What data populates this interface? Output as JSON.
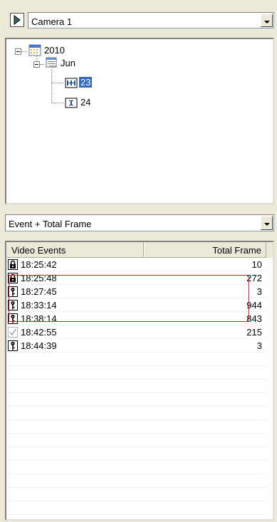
{
  "camera_select": {
    "value": "Camera 1"
  },
  "tree": {
    "year": "2010",
    "month": "Jun",
    "days": [
      {
        "label": "23",
        "selected": true
      },
      {
        "label": "24",
        "selected": false
      }
    ]
  },
  "view_select": {
    "value": "Event + Total Frame"
  },
  "events_table": {
    "columns": [
      "Video Events",
      "Total Frame"
    ],
    "rows": [
      {
        "icon": "lock-icon",
        "time": "18:25:42",
        "frames": "10"
      },
      {
        "icon": "lock-icon",
        "time": "18:25:48",
        "frames": "272"
      },
      {
        "icon": "key-icon",
        "time": "18:27:45",
        "frames": "3"
      },
      {
        "icon": "key-icon",
        "time": "18:33:14",
        "frames": "944"
      },
      {
        "icon": "key-icon",
        "time": "18:38:14",
        "frames": "843"
      },
      {
        "icon": "checkmark-icon",
        "time": "18:42:55",
        "frames": "215"
      },
      {
        "icon": "key-icon",
        "time": "18:44:39",
        "frames": "3"
      }
    ]
  },
  "colors": {
    "selection": "#316ac5",
    "highlight_border": "#e02020",
    "panel_bg": "#ece9d8"
  }
}
